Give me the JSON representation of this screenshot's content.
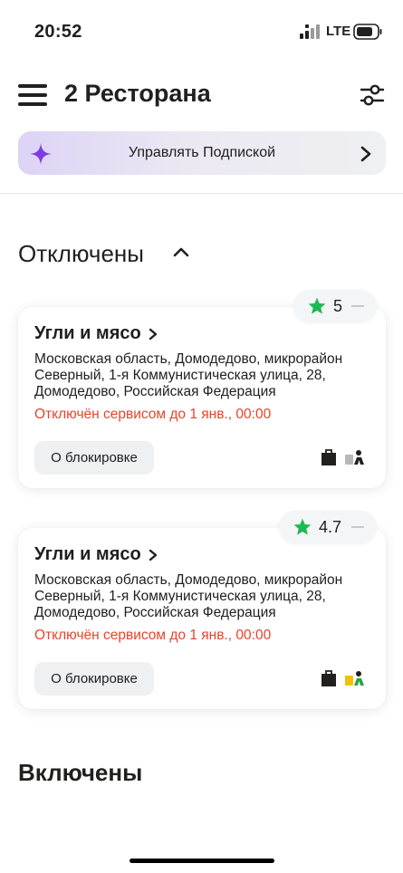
{
  "status_bar": {
    "time": "20:52",
    "network": "LTE"
  },
  "header": {
    "title": "2 Ресторана"
  },
  "subscription_banner": {
    "label": "Управлять Подпиской"
  },
  "sections": {
    "disabled": {
      "title": "Отключены"
    },
    "enabled": {
      "title": "Включены"
    }
  },
  "restaurants": [
    {
      "name": "Угли и мясо",
      "rating": "5",
      "address": "Московская область, Домодедово, микрорайон Северный, 1-я Коммунистическая улица, 28, Домодедово, Российская Федерация",
      "status": "Отключён сервисом до 1 янв., 00:00",
      "block_button": "О блокировке"
    },
    {
      "name": "Угли и мясо",
      "rating": "4.7",
      "address": "Московская область, Домодедово, микрорайон Северный, 1-я Коммунистическая улица, 28, Домодедово, Российская Федерация",
      "status": "Отключён сервисом до 1 янв., 00:00",
      "block_button": "О блокировке"
    }
  ],
  "colors": {
    "text": "#21201f",
    "status_red": "#e8432b",
    "star_green": "#1db954",
    "sparkle_purple": "#7b3fe4",
    "delivery_yellow": "#f2c200",
    "delivery_green": "#2aa24a"
  },
  "icons": [
    "menu-icon",
    "filter-icon",
    "sparkle-icon",
    "chevron-right-icon",
    "chevron-up-icon",
    "star-icon",
    "bag-icon",
    "courier-icon"
  ]
}
